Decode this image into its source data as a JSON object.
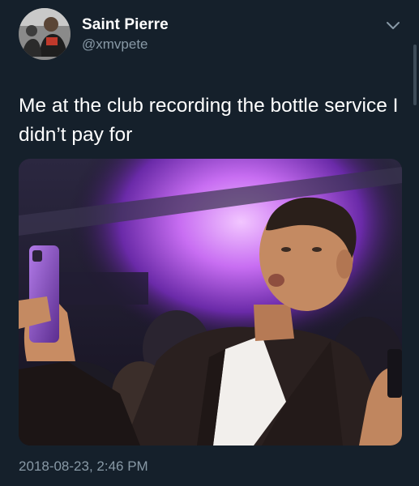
{
  "tweet": {
    "display_name": "Saint Pierre",
    "handle": "@xmvpete",
    "text": "Me at the club recording the bottle service I didn’t pay for",
    "timestamp": "2018-08-23, 2:46 PM",
    "avatar_icon": "profile-avatar",
    "menu_icon": "chevron-down-icon",
    "media": "embedded-photo"
  },
  "colors": {
    "background": "#15202b",
    "secondary_text": "#8899a6",
    "primary_text": "#ffffff"
  }
}
